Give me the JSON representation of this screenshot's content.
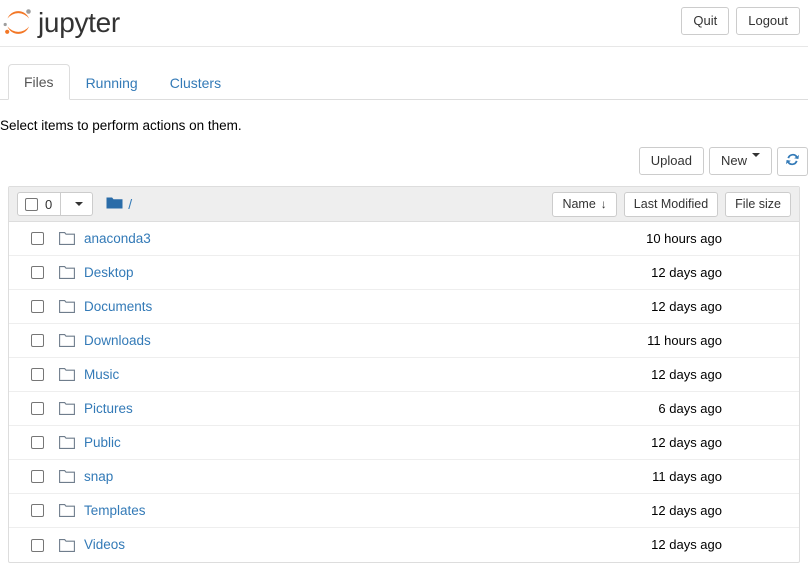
{
  "header": {
    "brand_text": "jupyter",
    "logo_icon": "jupyter-logo-icon",
    "quit_label": "Quit",
    "logout_label": "Logout"
  },
  "tabs": [
    {
      "label": "Files",
      "active": true
    },
    {
      "label": "Running",
      "active": false
    },
    {
      "label": "Clusters",
      "active": false
    }
  ],
  "info_text": "Select items to perform actions on them.",
  "toolbar": {
    "upload_label": "Upload",
    "new_label": "New",
    "new_caret_icon": "chevron-down-icon",
    "refresh_icon": "refresh-icon"
  },
  "list_header": {
    "selected_count": "0",
    "select_all_checkbox_icon": "checkbox-unchecked-icon",
    "dropdown_caret_icon": "chevron-down-icon",
    "breadcrumb_folder_icon": "folder-filled-icon",
    "breadcrumb_path": "/",
    "sort_name_label": "Name",
    "sort_name_arrow": "↓",
    "sort_last_modified_label": "Last Modified",
    "sort_file_size_label": "File size"
  },
  "colors": {
    "link_blue": "#337ab7",
    "logo_orange": "#f37726",
    "logo_gray": "#9e9e9e",
    "header_bg": "#eeeeee",
    "border_gray": "#dddddd",
    "folder_blue": "#2a6ca8"
  },
  "files": [
    {
      "name": "anaconda3",
      "modified": "10 hours ago",
      "icon": "folder-icon"
    },
    {
      "name": "Desktop",
      "modified": "12 days ago",
      "icon": "folder-icon"
    },
    {
      "name": "Documents",
      "modified": "12 days ago",
      "icon": "folder-icon"
    },
    {
      "name": "Downloads",
      "modified": "11 hours ago",
      "icon": "folder-icon"
    },
    {
      "name": "Music",
      "modified": "12 days ago",
      "icon": "folder-icon"
    },
    {
      "name": "Pictures",
      "modified": "6 days ago",
      "icon": "folder-icon"
    },
    {
      "name": "Public",
      "modified": "12 days ago",
      "icon": "folder-icon"
    },
    {
      "name": "snap",
      "modified": "11 days ago",
      "icon": "folder-icon"
    },
    {
      "name": "Templates",
      "modified": "12 days ago",
      "icon": "folder-icon"
    },
    {
      "name": "Videos",
      "modified": "12 days ago",
      "icon": "folder-icon"
    }
  ]
}
